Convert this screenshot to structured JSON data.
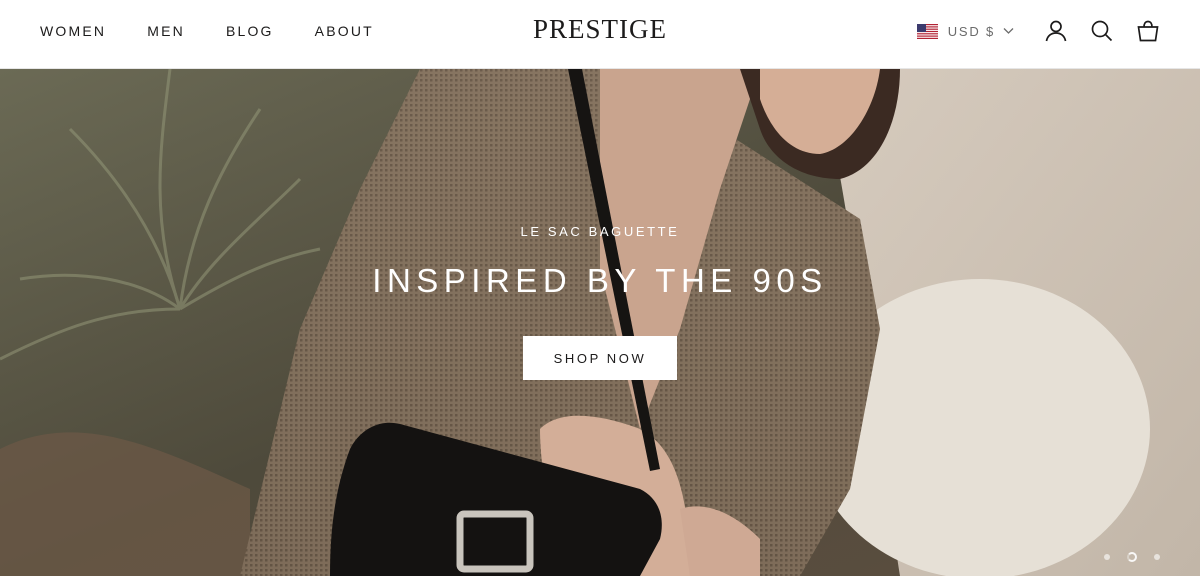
{
  "nav": {
    "items": [
      {
        "label": "WOMEN"
      },
      {
        "label": "MEN"
      },
      {
        "label": "BLOG"
      },
      {
        "label": "ABOUT"
      }
    ]
  },
  "brand": {
    "logo": "PRESTIGE"
  },
  "tools": {
    "currency": "USD $",
    "currency_flag": "us-flag-icon",
    "icons": [
      "account-icon",
      "search-icon",
      "cart-icon"
    ]
  },
  "hero": {
    "subheading": "LE SAC BAGUETTE",
    "heading": "INSPIRED BY THE 90S",
    "button_label": "SHOP NOW",
    "slides_count": 3,
    "active_slide": 2
  },
  "colors": {
    "text": "#1c1b1b",
    "muted": "#6b6b6b",
    "background": "#ffffff"
  }
}
